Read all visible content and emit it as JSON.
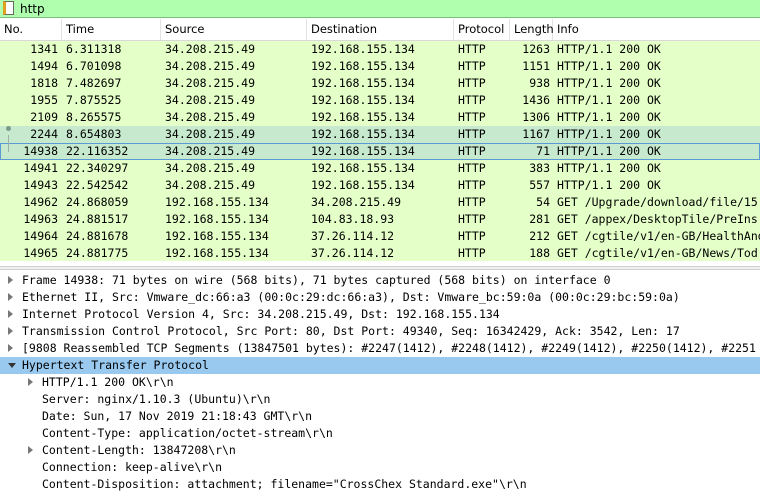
{
  "filter": {
    "value": "http"
  },
  "columns": [
    "No.",
    "Time",
    "Source",
    "Destination",
    "Protocol",
    "Length",
    "Info"
  ],
  "packets": [
    {
      "no": "1341",
      "time": "6.311318",
      "src": "34.208.215.49",
      "dst": "192.168.155.134",
      "proto": "HTTP",
      "len": "1263",
      "info": "HTTP/1.1 200 OK",
      "state": "normal"
    },
    {
      "no": "1494",
      "time": "6.701098",
      "src": "34.208.215.49",
      "dst": "192.168.155.134",
      "proto": "HTTP",
      "len": "1151",
      "info": "HTTP/1.1 200 OK",
      "state": "normal"
    },
    {
      "no": "1818",
      "time": "7.482697",
      "src": "34.208.215.49",
      "dst": "192.168.155.134",
      "proto": "HTTP",
      "len": "938",
      "info": "HTTP/1.1 200 OK",
      "state": "normal"
    },
    {
      "no": "1955",
      "time": "7.875525",
      "src": "34.208.215.49",
      "dst": "192.168.155.134",
      "proto": "HTTP",
      "len": "1436",
      "info": "HTTP/1.1 200 OK",
      "state": "normal"
    },
    {
      "no": "2109",
      "time": "8.265575",
      "src": "34.208.215.49",
      "dst": "192.168.155.134",
      "proto": "HTTP",
      "len": "1306",
      "info": "HTTP/1.1 200 OK",
      "state": "normal"
    },
    {
      "no": "2244",
      "time": "8.654803",
      "src": "34.208.215.49",
      "dst": "192.168.155.134",
      "proto": "HTTP",
      "len": "1167",
      "info": "HTTP/1.1 200 OK",
      "state": "related"
    },
    {
      "no": "14938",
      "time": "22.116352",
      "src": "34.208.215.49",
      "dst": "192.168.155.134",
      "proto": "HTTP",
      "len": "71",
      "info": "HTTP/1.1 200 OK",
      "state": "selected"
    },
    {
      "no": "14941",
      "time": "22.340297",
      "src": "34.208.215.49",
      "dst": "192.168.155.134",
      "proto": "HTTP",
      "len": "383",
      "info": "HTTP/1.1 200 OK",
      "state": "normal"
    },
    {
      "no": "14943",
      "time": "22.542542",
      "src": "34.208.215.49",
      "dst": "192.168.155.134",
      "proto": "HTTP",
      "len": "557",
      "info": "HTTP/1.1 200 OK",
      "state": "normal"
    },
    {
      "no": "14962",
      "time": "24.868059",
      "src": "192.168.155.134",
      "dst": "34.208.215.49",
      "proto": "HTTP",
      "len": "54",
      "info": "GET /Upgrade/download/file/15",
      "state": "normal"
    },
    {
      "no": "14963",
      "time": "24.881517",
      "src": "192.168.155.134",
      "dst": "104.83.18.93",
      "proto": "HTTP",
      "len": "281",
      "info": "GET /appex/DesktopTile/PreIns",
      "state": "normal"
    },
    {
      "no": "14964",
      "time": "24.881678",
      "src": "192.168.155.134",
      "dst": "37.26.114.12",
      "proto": "HTTP",
      "len": "212",
      "info": "GET /cgtile/v1/en-GB/HealthAnd",
      "state": "normal"
    },
    {
      "no": "14965",
      "time": "24.881775",
      "src": "192.168.155.134",
      "dst": "37.26.114.12",
      "proto": "HTTP",
      "len": "188",
      "info": "GET /cgtile/v1/en-GB/News/Tod",
      "state": "normal"
    }
  ],
  "details": [
    {
      "text": "Frame 14938: 71 bytes on wire (568 bits), 71 bytes captured (568 bits) on interface 0",
      "indent": 0,
      "toggle": "collapsed",
      "highlight": false
    },
    {
      "text": "Ethernet II, Src: Vmware_dc:66:a3 (00:0c:29:dc:66:a3), Dst: Vmware_bc:59:0a (00:0c:29:bc:59:0a)",
      "indent": 0,
      "toggle": "collapsed",
      "highlight": false
    },
    {
      "text": "Internet Protocol Version 4, Src: 34.208.215.49, Dst: 192.168.155.134",
      "indent": 0,
      "toggle": "collapsed",
      "highlight": false
    },
    {
      "text": "Transmission Control Protocol, Src Port: 80, Dst Port: 49340, Seq: 16342429, Ack: 3542, Len: 17",
      "indent": 0,
      "toggle": "collapsed",
      "highlight": false
    },
    {
      "text": "[9808 Reassembled TCP Segments (13847501 bytes): #2247(1412), #2248(1412), #2249(1412), #2250(1412), #2251",
      "indent": 0,
      "toggle": "collapsed",
      "highlight": false
    },
    {
      "text": "Hypertext Transfer Protocol",
      "indent": 0,
      "toggle": "expanded",
      "highlight": true
    },
    {
      "text": "HTTP/1.1 200 OK\\r\\n",
      "indent": 1,
      "toggle": "collapsed",
      "highlight": false
    },
    {
      "text": "Server: nginx/1.10.3 (Ubuntu)\\r\\n",
      "indent": 1,
      "toggle": "none",
      "highlight": false
    },
    {
      "text": "Date: Sun, 17 Nov 2019 21:18:43 GMT\\r\\n",
      "indent": 1,
      "toggle": "none",
      "highlight": false
    },
    {
      "text": "Content-Type: application/octet-stream\\r\\n",
      "indent": 1,
      "toggle": "none",
      "highlight": false
    },
    {
      "text": "Content-Length: 13847208\\r\\n",
      "indent": 1,
      "toggle": "collapsed",
      "highlight": false
    },
    {
      "text": "Connection: keep-alive\\r\\n",
      "indent": 1,
      "toggle": "none",
      "highlight": false
    },
    {
      "text": "Content-Disposition: attachment; filename=\"CrossChex Standard.exe\"\\r\\n",
      "indent": 1,
      "toggle": "none",
      "highlight": false
    }
  ],
  "colors": {
    "row_bg": "#e4ffc7",
    "row_selected": "#c7eacf",
    "filter_bg": "#afffaf",
    "detail_highlight": "#99c9ef"
  }
}
